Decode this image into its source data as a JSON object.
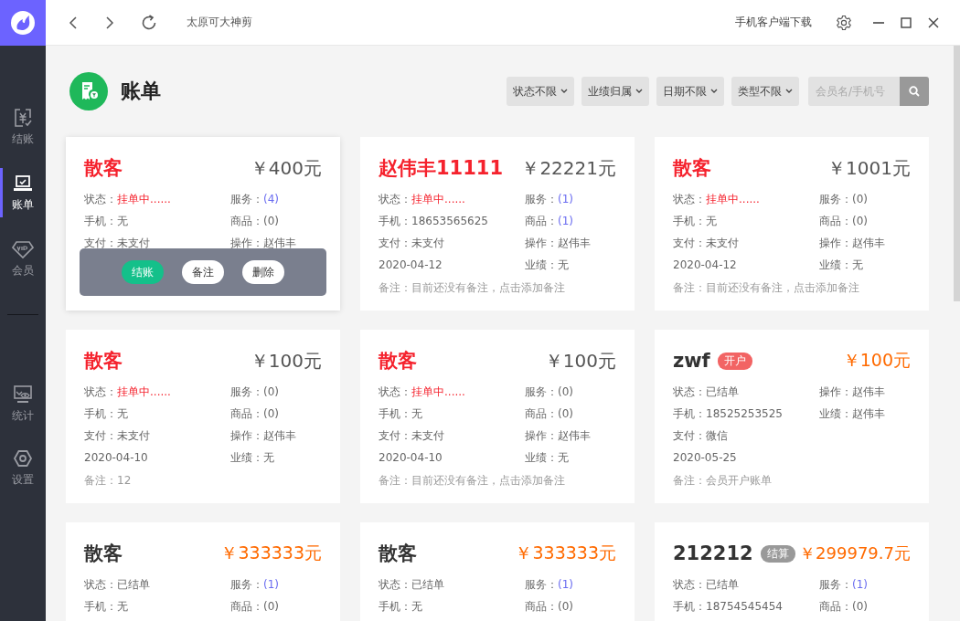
{
  "titlebar": {
    "title": "太原可大神剪",
    "download": "手机客户端下载"
  },
  "sidebar": {
    "top": [
      {
        "label": "结账",
        "kind": "checkout",
        "selected": false
      },
      {
        "label": "账单",
        "kind": "bill",
        "selected": true
      },
      {
        "label": "会员",
        "kind": "member",
        "selected": false
      }
    ],
    "bottom": [
      {
        "label": "统计",
        "kind": "stats",
        "selected": false
      },
      {
        "label": "设置",
        "kind": "settings",
        "selected": false
      }
    ]
  },
  "page": {
    "title": "账单"
  },
  "filters": [
    "状态不限",
    "业绩归属",
    "日期不限",
    "类型不限"
  ],
  "search": {
    "placeholder": "会员名/手机号"
  },
  "cards": [
    {
      "name": "散客",
      "settled": false,
      "amount": "￥400元",
      "fields": [
        {
          "label": "状态：",
          "value": "挂单中......",
          "kind": "alert"
        },
        {
          "label": "服务：",
          "value": "(4)",
          "kind": "link"
        },
        {
          "label": "手机：",
          "value": "无",
          "kind": "text"
        },
        {
          "label": "商品：",
          "value": "(0)",
          "kind": "text"
        },
        {
          "label": "支付：",
          "value": "未支付",
          "kind": "text"
        },
        {
          "label": "操作：",
          "value": "赵伟丰",
          "kind": "text"
        }
      ],
      "actions": [
        {
          "label": "结账",
          "kind": "primary"
        },
        {
          "label": "备注",
          "kind": "plain"
        },
        {
          "label": "删除",
          "kind": "plain"
        }
      ]
    },
    {
      "name": "赵伟丰11111",
      "settled": false,
      "amount": "￥22221元",
      "fields": [
        {
          "label": "状态：",
          "value": "挂单中......",
          "kind": "alert"
        },
        {
          "label": "服务：",
          "value": "(1)",
          "kind": "link"
        },
        {
          "label": "手机：",
          "value": "18653565625",
          "kind": "text"
        },
        {
          "label": "商品：",
          "value": "(1)",
          "kind": "link"
        },
        {
          "label": "支付：",
          "value": "未支付",
          "kind": "text"
        },
        {
          "label": "操作：",
          "value": "赵伟丰",
          "kind": "text"
        },
        {
          "label": "2020-04-12",
          "kind": "text"
        },
        {
          "label": "业绩：",
          "value": "无",
          "kind": "text"
        }
      ],
      "note": "备注：目前还没有备注，点击添加备注"
    },
    {
      "name": "散客",
      "settled": false,
      "amount": "￥1001元",
      "fields": [
        {
          "label": "状态：",
          "value": "挂单中......",
          "kind": "alert"
        },
        {
          "label": "服务：",
          "value": "(0)",
          "kind": "text"
        },
        {
          "label": "手机：",
          "value": "无",
          "kind": "text"
        },
        {
          "label": "商品：",
          "value": "(0)",
          "kind": "text"
        },
        {
          "label": "支付：",
          "value": "未支付",
          "kind": "text"
        },
        {
          "label": "操作：",
          "value": "赵伟丰",
          "kind": "text"
        },
        {
          "label": "2020-04-12",
          "kind": "text"
        },
        {
          "label": "业绩：",
          "value": "无",
          "kind": "text"
        }
      ],
      "note": "备注：目前还没有备注，点击添加备注"
    },
    {
      "name": "散客",
      "settled": false,
      "amount": "￥100元",
      "fields": [
        {
          "label": "状态：",
          "value": "挂单中......",
          "kind": "alert"
        },
        {
          "label": "服务：",
          "value": "(0)",
          "kind": "text"
        },
        {
          "label": "手机：",
          "value": "无",
          "kind": "text"
        },
        {
          "label": "商品：",
          "value": "(0)",
          "kind": "text"
        },
        {
          "label": "支付：",
          "value": "未支付",
          "kind": "text"
        },
        {
          "label": "操作：",
          "value": "赵伟丰",
          "kind": "text"
        },
        {
          "label": "2020-04-10",
          "kind": "text"
        },
        {
          "label": "业绩：",
          "value": "无",
          "kind": "text"
        }
      ],
      "note": "备注：12"
    },
    {
      "name": "散客",
      "settled": false,
      "amount": "￥100元",
      "fields": [
        {
          "label": "状态：",
          "value": "挂单中......",
          "kind": "alert"
        },
        {
          "label": "服务：",
          "value": "(0)",
          "kind": "text"
        },
        {
          "label": "手机：",
          "value": "无",
          "kind": "text"
        },
        {
          "label": "商品：",
          "value": "(0)",
          "kind": "text"
        },
        {
          "label": "支付：",
          "value": "未支付",
          "kind": "text"
        },
        {
          "label": "操作：",
          "value": "赵伟丰",
          "kind": "text"
        },
        {
          "label": "2020-04-10",
          "kind": "text"
        },
        {
          "label": "业绩：",
          "value": "无",
          "kind": "text"
        }
      ],
      "note": "备注：目前还没有备注，点击添加备注"
    },
    {
      "name": "zwf",
      "tag": {
        "label": "开户",
        "color": "#f26464"
      },
      "settled": true,
      "amount": "￥100元",
      "fields": [
        {
          "label": "状态：",
          "value": "已结单",
          "kind": "text"
        },
        {
          "label": "操作：",
          "value": "赵伟丰",
          "kind": "text"
        },
        {
          "label": "手机：",
          "value": "18525253525",
          "kind": "text"
        },
        {
          "label": "业绩：",
          "value": "赵伟丰",
          "kind": "text"
        },
        {
          "label": "支付：",
          "value": "微信",
          "kind": "text"
        },
        {
          "kind": "empty"
        },
        {
          "label": "2020-05-25",
          "kind": "text"
        }
      ],
      "note": "备注：会员开户账单"
    },
    {
      "name": "散客",
      "settled": true,
      "amount": "￥333333元",
      "fields": [
        {
          "label": "状态：",
          "value": "已结单",
          "kind": "text"
        },
        {
          "label": "服务：",
          "value": "(1)",
          "kind": "link"
        },
        {
          "label": "手机：",
          "value": "无",
          "kind": "text"
        },
        {
          "label": "商品：",
          "value": "(0)",
          "kind": "text"
        }
      ]
    },
    {
      "name": "散客",
      "settled": true,
      "amount": "￥333333元",
      "fields": [
        {
          "label": "状态：",
          "value": "已结单",
          "kind": "text"
        },
        {
          "label": "服务：",
          "value": "(1)",
          "kind": "link"
        },
        {
          "label": "手机：",
          "value": "无",
          "kind": "text"
        },
        {
          "label": "商品：",
          "value": "(0)",
          "kind": "text"
        }
      ]
    },
    {
      "name": "212212",
      "tag": {
        "label": "结算",
        "color": "#999999"
      },
      "settled": true,
      "amount": "￥299979.7元",
      "fields": [
        {
          "label": "状态：",
          "value": "已结单",
          "kind": "text"
        },
        {
          "label": "服务：",
          "value": "(1)",
          "kind": "link"
        },
        {
          "label": "手机：",
          "value": "18754545454",
          "kind": "text"
        },
        {
          "label": "商品：",
          "value": "(0)",
          "kind": "text"
        }
      ]
    }
  ]
}
